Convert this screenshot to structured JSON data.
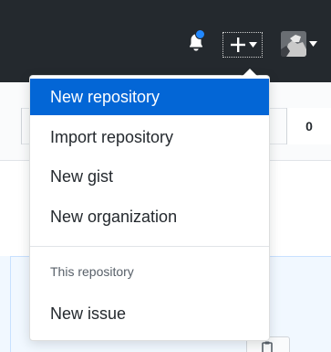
{
  "header": {
    "notification_icon": "bell-icon",
    "create_icon": "plus-icon",
    "create_caret_icon": "caret-down-icon",
    "avatar_caret_icon": "caret-down-icon",
    "notification_dot_color": "#2188ff",
    "background": "#24292e"
  },
  "repo": {
    "counter_value": "0",
    "copy_icon": "clipboard-icon"
  },
  "dropdown": {
    "items": [
      {
        "label": "New repository",
        "active": true
      },
      {
        "label": "Import repository",
        "active": false
      },
      {
        "label": "New gist",
        "active": false
      },
      {
        "label": "New organization",
        "active": false
      }
    ],
    "section_header": "This repository",
    "section_items": [
      {
        "label": "New issue",
        "active": false
      }
    ],
    "active_color": "#0366d6"
  }
}
